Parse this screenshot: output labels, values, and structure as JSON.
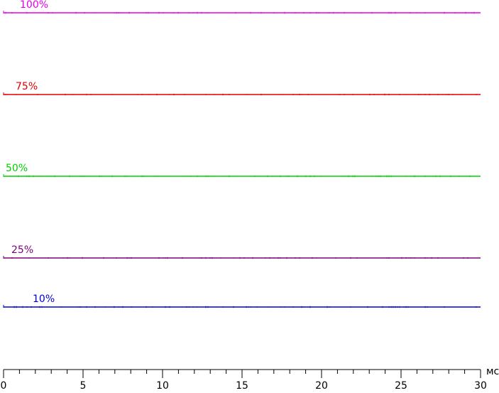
{
  "chart_data": {
    "type": "line",
    "title": "",
    "xlabel": "",
    "ylabel": "",
    "x_unit": "мс",
    "xlim": [
      0,
      30
    ],
    "x_ticks": [
      "0",
      "5",
      "10",
      "15",
      "20",
      "25",
      "30"
    ],
    "minor_tick_step": 1,
    "grid": false,
    "legend": "none (labels placed above each line)",
    "series": [
      {
        "name": "100%",
        "color": "#e600e6",
        "x": [
          0,
          30
        ],
        "y": [
          100,
          100
        ]
      },
      {
        "name": "75%",
        "color": "#e00000",
        "x": [
          0,
          30
        ],
        "y": [
          75,
          75
        ]
      },
      {
        "name": "50%",
        "color": "#00d000",
        "x": [
          0,
          30
        ],
        "y": [
          50,
          50
        ]
      },
      {
        "name": "25%",
        "color": "#80007a",
        "x": [
          0,
          30
        ],
        "y": [
          25,
          25
        ]
      },
      {
        "name": "10%",
        "color": "#0000d0",
        "x": [
          0,
          30
        ],
        "y": [
          10,
          10
        ]
      }
    ]
  }
}
